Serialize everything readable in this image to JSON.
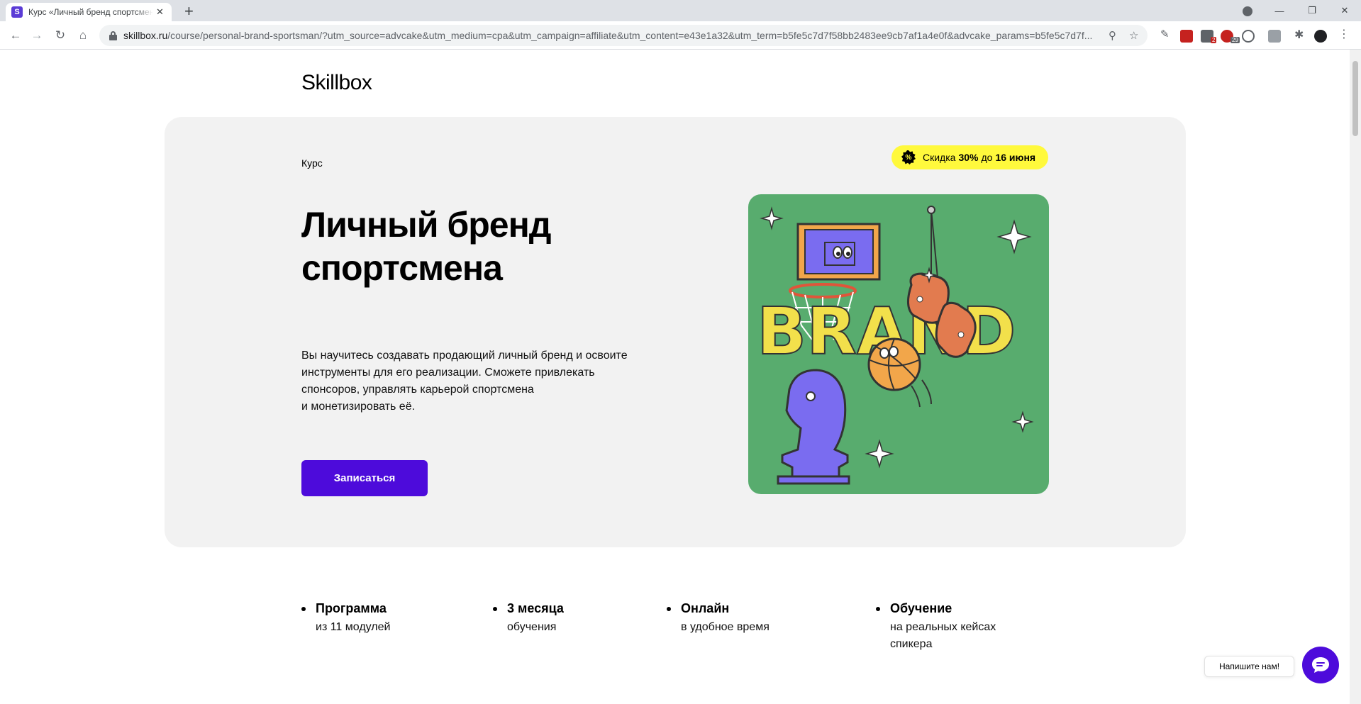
{
  "browser": {
    "tab_title": "Курс «Личный бренд спортсмена»",
    "tab_favicon": "S",
    "url_host": "skillbox.ru",
    "url_rest": "/course/personal-brand-sportsman/?utm_source=advcake&utm_medium=cpa&utm_campaign=affiliate&utm_content=e43e1a32&utm_term=b5fe5c7d7f58bb2483ee9cb7af1a4e0f&advcake_params=b5fe5c7d7f...",
    "ext_badges": [
      "2",
      "29"
    ]
  },
  "site": {
    "logo": "Skillbox"
  },
  "hero": {
    "kicker": "Курс",
    "discount": {
      "prefix": "Скидка",
      "value": "30%",
      "middle": "до",
      "date": "16 июня",
      "icon_text": "%"
    },
    "title": "Личный бренд спортсмена",
    "description": "Вы научитесь создавать продающий личный бренд и освоите\nинструменты для его реализации. Сможете привлекать\nспонсоров, управлять карьерой спортсмена\nи монетизировать её.",
    "cta_label": "Записаться",
    "art_word": "BRAND"
  },
  "features": [
    {
      "title": "Программа",
      "subtitle": "из 11 модулей"
    },
    {
      "title": "3 месяца",
      "subtitle": "обучения"
    },
    {
      "title": "Онлайн",
      "subtitle": "в удобное время"
    },
    {
      "title": "Обучение",
      "subtitle": "на реальных кейсах\nспикера"
    }
  ],
  "chat": {
    "label": "Напишите нам!"
  },
  "colors": {
    "brand": "#4d0bdb",
    "discount_bg": "#fff93c",
    "hero_bg": "#f2f2f2",
    "art_bg": "#58ac6e"
  },
  "icons": [
    "back-icon",
    "forward-icon",
    "reload-icon",
    "home-icon",
    "lock-icon",
    "zoom-icon",
    "star-icon",
    "extensions-icon",
    "chat-icon"
  ]
}
